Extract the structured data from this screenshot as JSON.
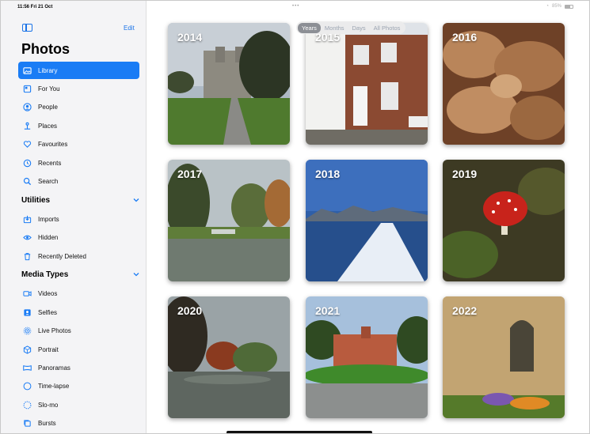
{
  "status_bar": {
    "time": "11:56  Fri 21 Oct",
    "indicators": "•••",
    "battery": "85%"
  },
  "sidebar": {
    "edit_label": "Edit",
    "title": "Photos",
    "items": [
      {
        "label": "Library",
        "icon": "library-icon",
        "active": true
      },
      {
        "label": "For You",
        "icon": "for-you-icon"
      },
      {
        "label": "People",
        "icon": "people-icon"
      },
      {
        "label": "Places",
        "icon": "places-icon"
      },
      {
        "label": "Favourites",
        "icon": "heart-icon"
      },
      {
        "label": "Recents",
        "icon": "clock-icon"
      },
      {
        "label": "Search",
        "icon": "search-icon"
      }
    ],
    "utilities_title": "Utilities",
    "utilities": [
      {
        "label": "Imports",
        "icon": "import-icon"
      },
      {
        "label": "Hidden",
        "icon": "eye-icon"
      },
      {
        "label": "Recently Deleted",
        "icon": "trash-icon"
      }
    ],
    "media_title": "Media Types",
    "media": [
      {
        "label": "Videos",
        "icon": "video-icon"
      },
      {
        "label": "Selfies",
        "icon": "selfie-icon"
      },
      {
        "label": "Live Photos",
        "icon": "live-photo-icon"
      },
      {
        "label": "Portrait",
        "icon": "portrait-icon"
      },
      {
        "label": "Panoramas",
        "icon": "panorama-icon"
      },
      {
        "label": "Time-lapse",
        "icon": "timelapse-icon"
      },
      {
        "label": "Slo-mo",
        "icon": "slomo-icon"
      },
      {
        "label": "Bursts",
        "icon": "bursts-icon"
      }
    ]
  },
  "view_selector": {
    "options": [
      "Years",
      "Months",
      "Days",
      "All Photos"
    ],
    "selected": "Years"
  },
  "years": [
    "2014",
    "2015",
    "2016",
    "2017",
    "2018",
    "2019",
    "2020",
    "2021",
    "2022"
  ],
  "colors": {
    "accent": "#1a7cf5",
    "sidebar_bg": "#f4f4f6"
  }
}
